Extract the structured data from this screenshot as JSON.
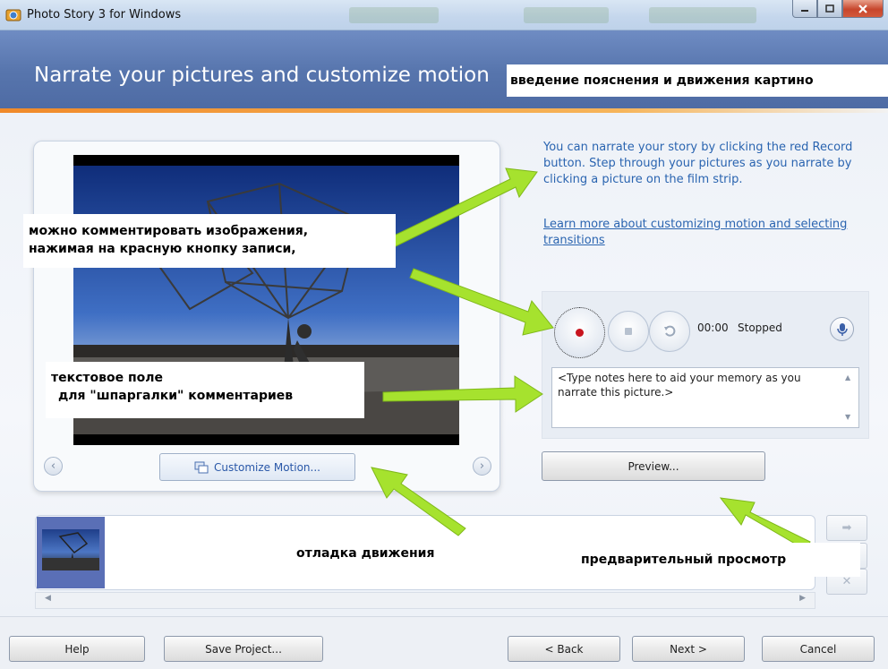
{
  "window": {
    "title": "Photo Story 3 for Windows",
    "icons": {
      "app": "photo-story-app-icon",
      "minimize": "minimize-icon",
      "maximize": "maximize-icon",
      "close": "close-icon"
    }
  },
  "header": {
    "title": "Narrate your pictures and customize motion"
  },
  "intro": {
    "text": "You can narrate your story by clicking the red Record button. Step through your pictures as you narrate by clicking a picture on the film strip.",
    "learn_link": "Learn more about customizing motion and selecting transitions"
  },
  "preview": {
    "customize_motion_label": "Customize Motion...",
    "icons": {
      "prev": "chevron-left-icon",
      "next": "chevron-right-icon",
      "customize": "customize-motion-icon"
    }
  },
  "narration": {
    "timer": "00:00",
    "status": "Stopped",
    "notes_placeholder": "<Type notes here to aid your memory as you narrate this picture.>",
    "icons": {
      "record": "record-icon",
      "stop": "stop-icon",
      "undo": "undo-icon",
      "microphone": "microphone-icon"
    },
    "preview_label": "Preview..."
  },
  "filmstrip": {
    "icons": {
      "move_right": "arrow-right-icon",
      "move_left": "arrow-left-icon",
      "delete": "delete-x-icon"
    }
  },
  "footer": {
    "help_label": "Help",
    "save_label": "Save Project...",
    "back_label": "< Back",
    "next_label": "Next >",
    "cancel_label": "Cancel"
  },
  "annotations": {
    "header_note": "введение пояснения и движения картино",
    "narrate_note_line1": "можно комментировать изображения,",
    "narrate_note_line2": "нажимая на красную кнопку записи,",
    "notes_note_line1": "текстовое поле",
    "notes_note_line2": "для \"шпаргалки\" комментариев",
    "motion_note": "отладка движения",
    "preview_note": "предварительный просмотр"
  },
  "colors": {
    "header_bg": "#5775ad",
    "accent_orange": "#f08a2a",
    "link_blue": "#2a64b0",
    "arrow_green": "#a6e22e",
    "record_red": "#c8141e"
  }
}
